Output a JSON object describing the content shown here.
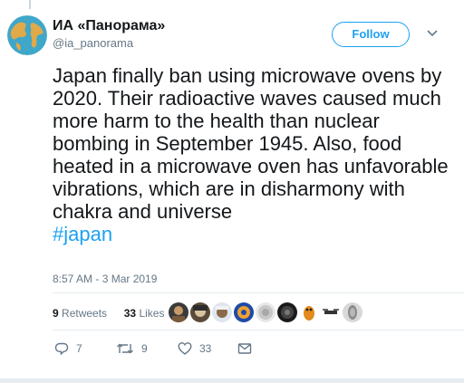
{
  "author": {
    "display_name": "ИА «Панорама»",
    "handle": "@ia_panorama",
    "avatar_icon": "globe-avatar-icon"
  },
  "follow_label": "Follow",
  "tweet": {
    "text": "Japan finally ban using microwave ovens by 2020. Their radioactive waves caused much more harm to the health than nuclear bombing in September 1945. Also, food heated in a microwave oven has unfavorable vibrations, which are in disharmony with chakra and universe",
    "hashtag": "#japan",
    "timestamp": "8:57 AM - 3 Mar 2019"
  },
  "stats": {
    "retweets_count": "9",
    "retweets_label": "Retweets",
    "likes_count": "33",
    "likes_label": "Likes"
  },
  "actions": {
    "reply_count": "7",
    "retweet_count": "9",
    "like_count": "33"
  },
  "colors": {
    "accent": "#1da1f2",
    "secondary_text": "#657786",
    "divider": "#e6ecf0"
  }
}
